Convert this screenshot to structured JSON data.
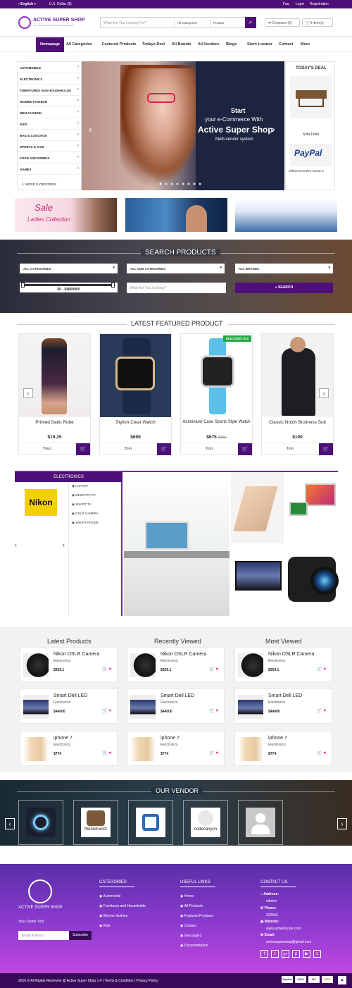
{
  "topbar": {
    "language": "English",
    "currency": "U.S. Dollar ($)",
    "faq": "Faq",
    "login": "Login",
    "registration": "Registration"
  },
  "header": {
    "logo_title": "ACTIVE SUPER SHOP",
    "logo_tagline": "Your One Stop for All Your Shopping Needs",
    "search_placeholder": "What Are You Looking For?",
    "category_select": "All Categories",
    "type_select": "Product",
    "compare": "Compare (0)",
    "cart": "0 item(s)"
  },
  "nav": {
    "items": [
      "Homepage",
      "All Categories",
      "Featured Products",
      "Todays Deal",
      "All Brands",
      "All Vendors",
      "Blogs",
      "Store Locator",
      "Contact",
      "More"
    ]
  },
  "categories": {
    "items": [
      "AUTOMOBILE",
      "ELECTRONICS",
      "FURNITURES AND HOUSEHOLDS",
      "WOMEN FASHION",
      "MEN FASHION",
      "KIDS",
      "BAG & LUGGAGE",
      "SPORTS & GYM",
      "FOOD AND DRINKS",
      "GAMES"
    ],
    "more": "MORE CATEGORIES"
  },
  "slider": {
    "line1": "Start",
    "line2": "your e-Commerce With",
    "line3": "Active Super Shop",
    "line4": "Multi-vendor system"
  },
  "todays_deal": {
    "title": "TODAY'S DEAL",
    "item1": "Sofa Table",
    "item2": "Officia inventore earum e"
  },
  "banners": {
    "sale_line1": "Sale",
    "sale_line2": "Ladies Collection"
  },
  "search_products": {
    "title": "SEARCH PRODUCTS",
    "all_categories": "ALL CATEGORIES",
    "all_sub_categories": "ALL SUB CATEGORIES",
    "all_brands": "ALL BRANDS",
    "price_range": "$0 - $4800000",
    "query_placeholder": "What Are You Looking?",
    "search_button": "SEARCH"
  },
  "featured": {
    "title": "LATEST FEATURED PRODUCT",
    "products": [
      {
        "name": "Printed Satin Robe",
        "price": "$19.25",
        "old": "",
        "vendor": "Youn"
      },
      {
        "name": "Stylish Clear Watch",
        "price": "$699",
        "old": "",
        "vendor": "Tom"
      },
      {
        "name": "Aluminium Case Sports Style Watch",
        "price": "$675",
        "old": "$685",
        "vendor": "Tom",
        "badge": "DISCOUNT $10"
      },
      {
        "name": "Classic Notch Business Suit",
        "price": "$100",
        "old": "",
        "vendor": "Tom"
      }
    ]
  },
  "electronics": {
    "title": "ELECTRONICS",
    "brand": "Nikon",
    "subs": [
      "LAPTOP",
      "DESKTOP PC",
      "SMART TV",
      "DSLR CAMERA",
      "SMART PHONE"
    ]
  },
  "lists": {
    "columns": [
      {
        "title": "Latest Products"
      },
      {
        "title": "Recently Viewed"
      },
      {
        "title": "Most Viewed"
      }
    ],
    "items": [
      {
        "name": "Nikon DSLR Camera",
        "cat": "Electronics",
        "price": "$359.1"
      },
      {
        "name": "Smart Dell LED",
        "cat": "Electronics",
        "price": "$44000"
      },
      {
        "name": "iphone 7",
        "cat": "Electronics",
        "price": "$774"
      }
    ]
  },
  "vendor": {
    "title": "OUR VENDOR",
    "themeforest": "themeforest",
    "codecanyon": "codecanyon"
  },
  "footer": {
    "logo_title": "ACTIVE SUPER SHOP",
    "footer_text": "Your Footer Text",
    "email_placeholder": "Email Address",
    "subscribe": "Subscribe",
    "categories_title": "CATEGORIES",
    "categories": [
      "Automobile",
      "Furnitures and Households",
      "Women fashion",
      "Kids"
    ],
    "links_title": "USEFUL LINKS",
    "links": [
      "Home",
      "All Products",
      "Featured Products",
      "Contact",
      "new page1",
      "Documentation"
    ],
    "contact_title": "CONTACT US",
    "address_label": "Address:",
    "address": "nikelon",
    "phone_label": "Phone:",
    "phone": "022555",
    "website_label": "Website:",
    "website": "www.activeitzone.com",
    "email_label": "Email:",
    "email": "activesupershop@gmail.com"
  },
  "bottom": {
    "copyright": "2016 © All Rights Reserved @ Active Super Shop 1.4 | Terms & Condition | Privacy Policy",
    "pay": [
      "PayPal",
      "VISA",
      "MC",
      "DISC"
    ]
  },
  "colors": {
    "brand": "#4f0f78",
    "accent_pink": "#ff1493",
    "discount_green": "#22a845"
  }
}
